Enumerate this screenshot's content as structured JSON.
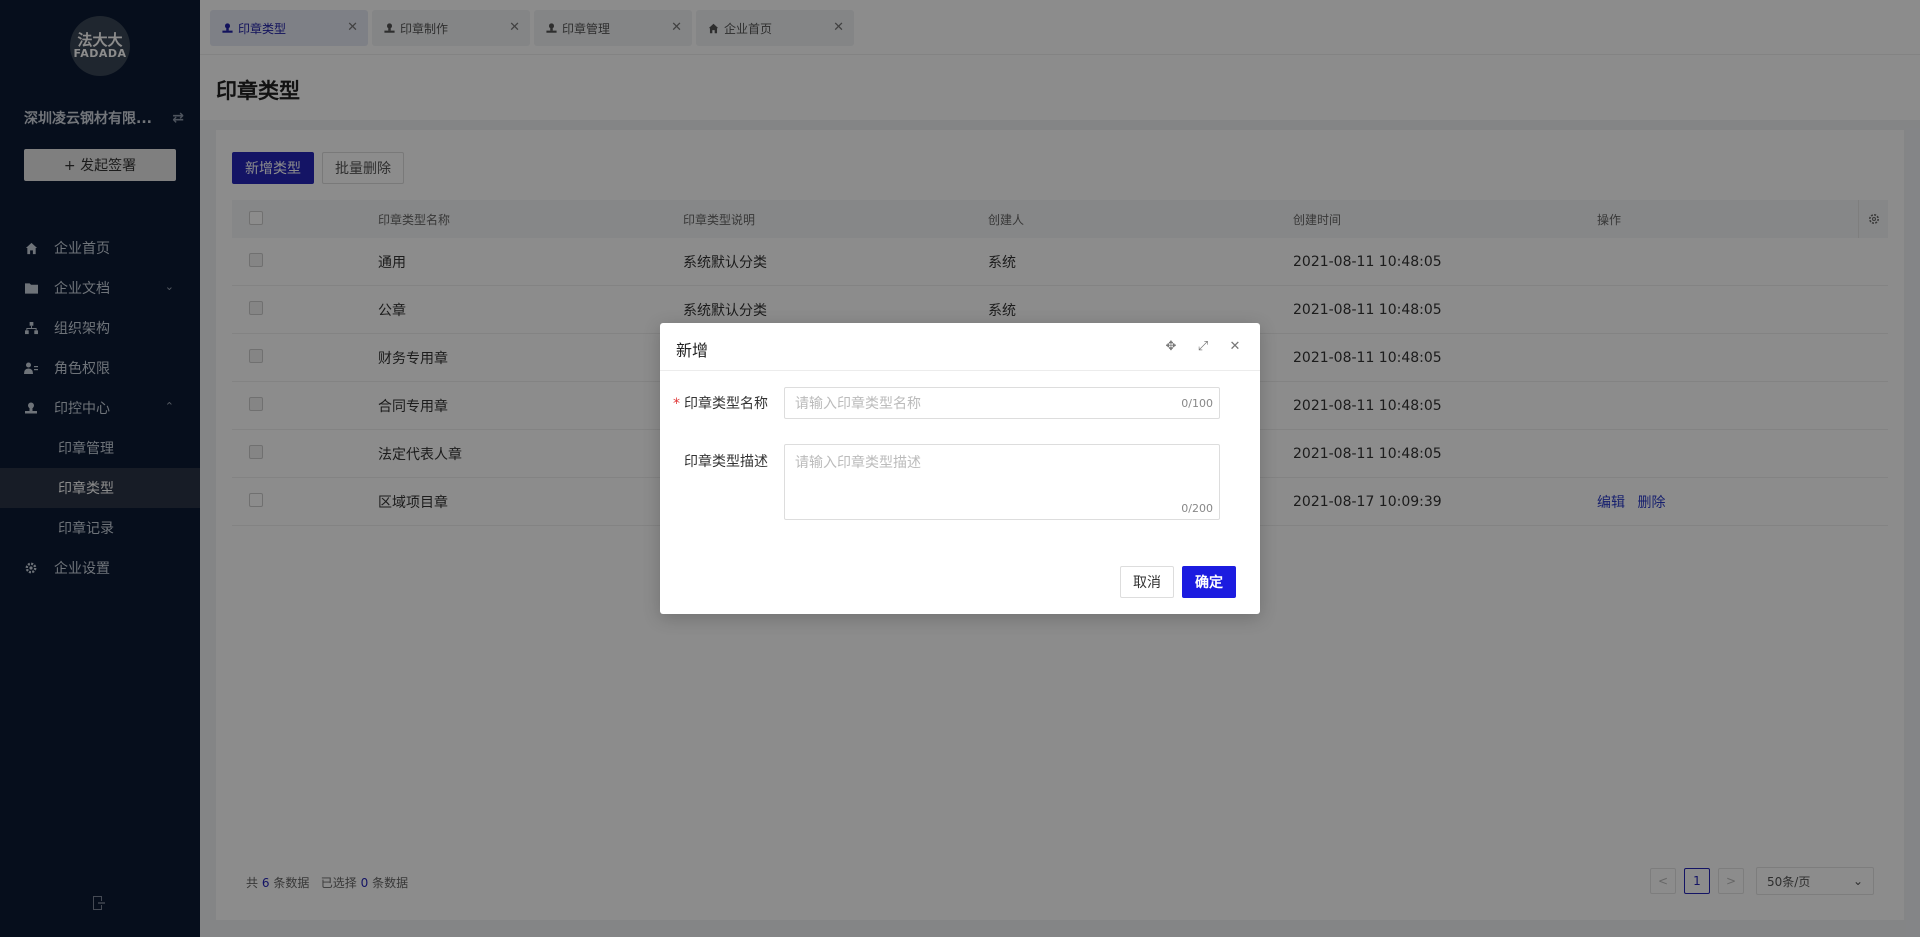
{
  "brand": {
    "logo_line1": "法大大",
    "logo_line2": "FADADA"
  },
  "sidebar": {
    "company_name": "深圳凌云钢材有限...",
    "swap_icon": "⇄",
    "start_button": "+ 发起签署",
    "items": [
      {
        "label": "企业首页",
        "icon": "home-icon"
      },
      {
        "label": "企业文档",
        "icon": "folder-icon",
        "chevron": "⌄"
      },
      {
        "label": "组织架构",
        "icon": "org-icon"
      },
      {
        "label": "角色权限",
        "icon": "role-icon"
      },
      {
        "label": "印控中心",
        "icon": "seal-icon",
        "chevron": "⌃"
      },
      {
        "label": "企业设置",
        "icon": "gear-icon"
      }
    ],
    "sub_items": [
      "印章管理",
      "印章类型",
      "印章记录"
    ]
  },
  "tabs": [
    {
      "label": "印章类型",
      "close": "✕"
    },
    {
      "label": "印章制作",
      "close": "✕"
    },
    {
      "label": "印章管理",
      "close": "✕"
    },
    {
      "label": "企业首页",
      "close": "✕"
    }
  ],
  "page": {
    "title": "印章类型"
  },
  "toolbar": {
    "add_label": "新增类型",
    "batch_delete_label": "批量删除"
  },
  "table": {
    "columns": [
      "印章类型名称",
      "印章类型说明",
      "创建人",
      "创建时间",
      "操作"
    ],
    "rows": [
      {
        "name": "通用",
        "desc": "系统默认分类",
        "creator": "系统",
        "time": "2021-08-11 10:48:05",
        "edit": "",
        "delete": ""
      },
      {
        "name": "公章",
        "desc": "系统默认分类",
        "creator": "系统",
        "time": "2021-08-11 10:48:05",
        "edit": "",
        "delete": ""
      },
      {
        "name": "财务专用章",
        "desc": "",
        "creator": "",
        "time": "2021-08-11 10:48:05",
        "edit": "",
        "delete": ""
      },
      {
        "name": "合同专用章",
        "desc": "",
        "creator": "",
        "time": "2021-08-11 10:48:05",
        "edit": "",
        "delete": ""
      },
      {
        "name": "法定代表人章",
        "desc": "",
        "creator": "",
        "time": "2021-08-11 10:48:05",
        "edit": "",
        "delete": ""
      },
      {
        "name": "区域项目章",
        "desc": "",
        "creator": "",
        "time": "2021-08-17 10:09:39",
        "edit": "编辑",
        "delete": "删除"
      }
    ]
  },
  "footer": {
    "total_prefix": "共",
    "total": "6",
    "total_suffix": "条数据",
    "selected_prefix": "已选择",
    "selected": "0",
    "selected_suffix": "条数据"
  },
  "pagination": {
    "prev": "<",
    "current": "1",
    "next": ">",
    "page_size": "50条/页",
    "dropdown": "⌄"
  },
  "modal": {
    "title": "新增",
    "name_label": "印章类型名称",
    "required_mark": "*",
    "name_placeholder": "请输入印章类型名称",
    "name_count": "0/100",
    "desc_label": "印章类型描述",
    "desc_placeholder": "请输入印章类型描述",
    "desc_count": "0/200",
    "cancel": "取消",
    "ok": "确定",
    "move_icon": "✥",
    "fullscreen_icon": "⤢",
    "close_icon": "✕"
  }
}
